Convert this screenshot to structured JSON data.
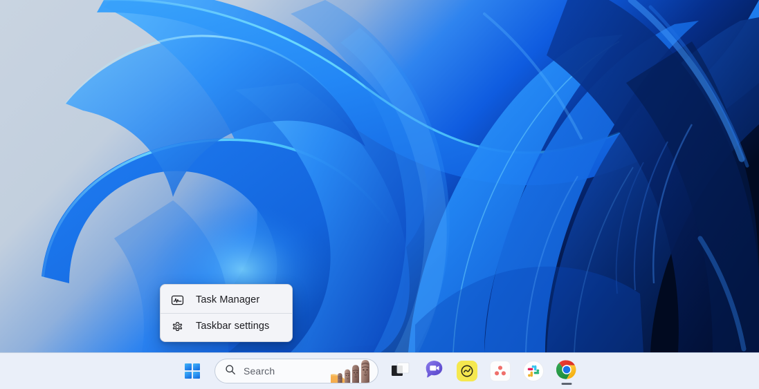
{
  "desktop": {
    "wallpaper_name": "windows-11-bloom-wallpaper",
    "background_colors": {
      "light_edge": "#c8d3e0",
      "mid_blue": "#1a6bf0",
      "bright_blue": "#2b8bf5",
      "cyan_highlight": "#5fd8ff",
      "deep_navy": "#041b52",
      "near_black": "#020b22"
    }
  },
  "context_menu": {
    "name": "taskbar-context-menu",
    "background_color": "#f3f4f8",
    "items": [
      {
        "label": "Task Manager",
        "icon": "task-manager-icon"
      },
      {
        "label": "Taskbar settings",
        "icon": "gear-icon"
      }
    ]
  },
  "taskbar": {
    "background_color": "#e8eef8",
    "start": {
      "label": "Start",
      "icon": "windows-logo-icon"
    },
    "search": {
      "placeholder": "Search",
      "value": "",
      "icon": "search-icon",
      "illustration": "moai-statues-image"
    },
    "buttons": [
      {
        "name": "task-view-button",
        "label": "Task view",
        "icon": "task-view-icon",
        "running": false
      },
      {
        "name": "chat-button",
        "label": "Chat",
        "icon": "teams-chat-icon",
        "running": false
      },
      {
        "name": "app-button-yellow",
        "label": "App",
        "icon": "yellow-wave-app-icon",
        "running": false
      },
      {
        "name": "asana-button",
        "label": "Asana",
        "icon": "asana-icon",
        "running": false
      },
      {
        "name": "slack-button",
        "label": "Slack",
        "icon": "slack-icon",
        "running": false
      },
      {
        "name": "chrome-button",
        "label": "Google Chrome",
        "icon": "chrome-icon",
        "running": true
      }
    ]
  }
}
